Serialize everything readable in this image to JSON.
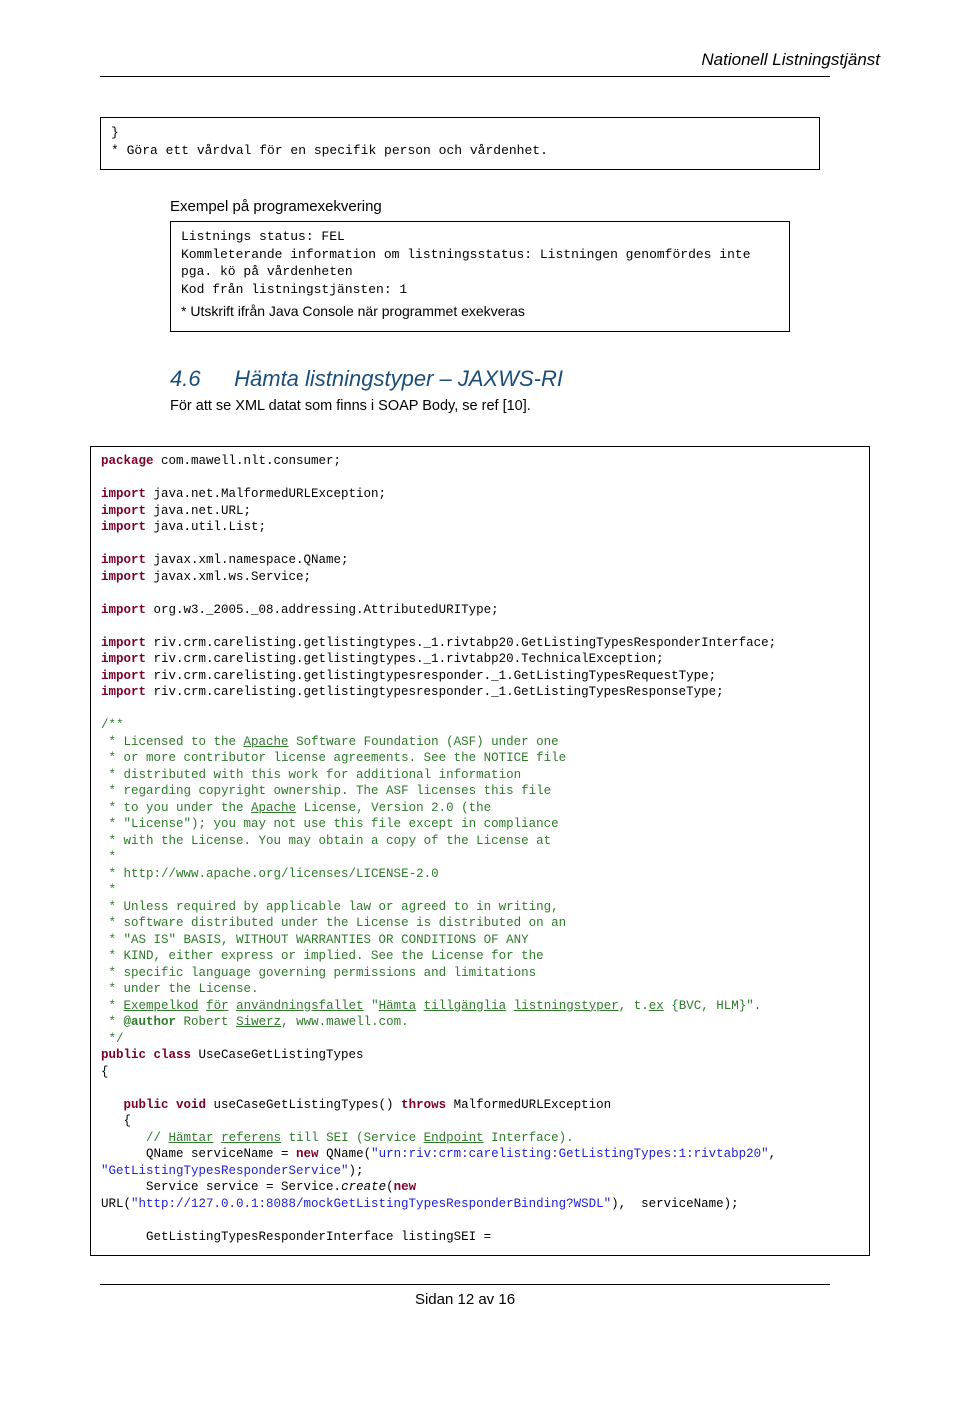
{
  "header": {
    "title": "Nationell Listningstjänst"
  },
  "box1": {
    "line1": "}",
    "line2": " * Göra ett vårdval för en specifik person och vårdenhet."
  },
  "sub_title": "Exempel på programexekvering",
  "box2": {
    "l1": "Listnings status: FEL",
    "l2": "Kommleterande information om listningsstatus: Listningen genomfördes inte pga. kö på vårdenheten",
    "l3": "Kod från listningstjänsten: 1",
    "l4": "* Utskrift ifrån Java Console när programmet exekveras"
  },
  "section": {
    "num": "4.6",
    "title": "Hämta listningstyper – JAXWS-RI",
    "body": "För att se XML datat som finns i SOAP Body, se ref [10]."
  },
  "code": {
    "pkg_kw": "package",
    "pkg": " com.mawell.nlt.consumer;",
    "imp_kw": "import",
    "imp1": " java.net.MalformedURLException;",
    "imp2": " java.net.URL;",
    "imp3": " java.util.List;",
    "imp4": " javax.xml.namespace.QName;",
    "imp5": " javax.xml.ws.Service;",
    "imp6": " org.w3._2005._08.addressing.AttributedURIType;",
    "imp7": " riv.crm.carelisting.getlistingtypes._1.rivtabp20.GetListingTypesResponderInterface;",
    "imp8": " riv.crm.carelisting.getlistingtypes._1.rivtabp20.TechnicalException;",
    "imp9": " riv.crm.carelisting.getlistingtypesresponder._1.GetListingTypesRequestType;",
    "imp10": " riv.crm.carelisting.getlistingtypesresponder._1.GetListingTypesResponseType;",
    "jd1": "/**",
    "jd2a": " * Licensed to the ",
    "jd2b": "Apache",
    "jd2c": " Software Foundation (ASF) under one",
    "jd3": " * or more contributor license agreements. See the NOTICE file",
    "jd4": " * distributed with this work for additional information",
    "jd5": " * regarding copyright ownership. The ASF licenses this file",
    "jd6a": " * to you under the ",
    "jd6b": "Apache",
    "jd6c": " License, Version 2.0 (the",
    "jd7": " * \"License\"); you may not use this file except in compliance",
    "jd8": " * with the License. You may obtain a copy of the License at",
    "jd9": " *",
    "jd10": " * http://www.apache.org/licenses/LICENSE-2.0",
    "jd11": " *",
    "jd12": " * Unless required by applicable law or agreed to in writing,",
    "jd13": " * software distributed under the License is distributed on an",
    "jd14": " * \"AS IS\" BASIS, WITHOUT WARRANTIES OR CONDITIONS OF ANY",
    "jd15": " * KIND, either express or implied. See the License for the",
    "jd16": " * specific language governing permissions and limitations",
    "jd17": " * under the License.",
    "jd18a": " * ",
    "jd18b": "Exempelkod",
    "jd18c": " ",
    "jd18d": "för",
    "jd18e": " ",
    "jd18f": "användningsfallet",
    "jd18g": " \"",
    "jd18h": "Hämta",
    "jd18i": " ",
    "jd18j": "tillgänglia",
    "jd18k": " ",
    "jd18l": "listningstyper",
    "jd18m": ", t.",
    "jd18n": "ex",
    "jd18o": " {BVC, HLM}\".",
    "jd19a": " * ",
    "jd19b": "@author",
    "jd19c": " Robert ",
    "jd19d": "Siwerz",
    "jd19e": ", www.mawell.com.",
    "jd20": " */",
    "cls1": "public class",
    "cls2": " UseCaseGetListingTypes",
    "brace_open": "{",
    "m1a": "   public void",
    "m1b": " useCaseGetListingTypes() ",
    "m1c": "throws",
    "m1d": " MalformedURLException",
    "m2": "   {",
    "c1a": "      // ",
    "c1b": "Hämtar",
    "c1c": " ",
    "c1d": "referens",
    "c1e": " till SEI (Service ",
    "c1f": "Endpoint",
    "c1g": " Interface).",
    "q1a": "      QName serviceName = ",
    "q1b": "new",
    "q1c": " QName(",
    "q1d": "\"urn:riv:crm:carelisting:GetListingTypes:1:rivtabp20\"",
    "q1e": ",",
    "q2a": "\"GetListingTypesResponderService\"",
    "q2b": ");",
    "s1a": "      Service service = Service.",
    "s1b": "create",
    "s1c": "(",
    "s1d": "new",
    "u1a": "URL(",
    "u1b": "\"http://127.0.0.1:8088/mockGetListingTypesResponderBinding?WSDL\"",
    "u1c": "),  serviceName);",
    "last": "      GetListingTypesResponderInterface listingSEI ="
  },
  "footer": "Sidan 12 av 16"
}
